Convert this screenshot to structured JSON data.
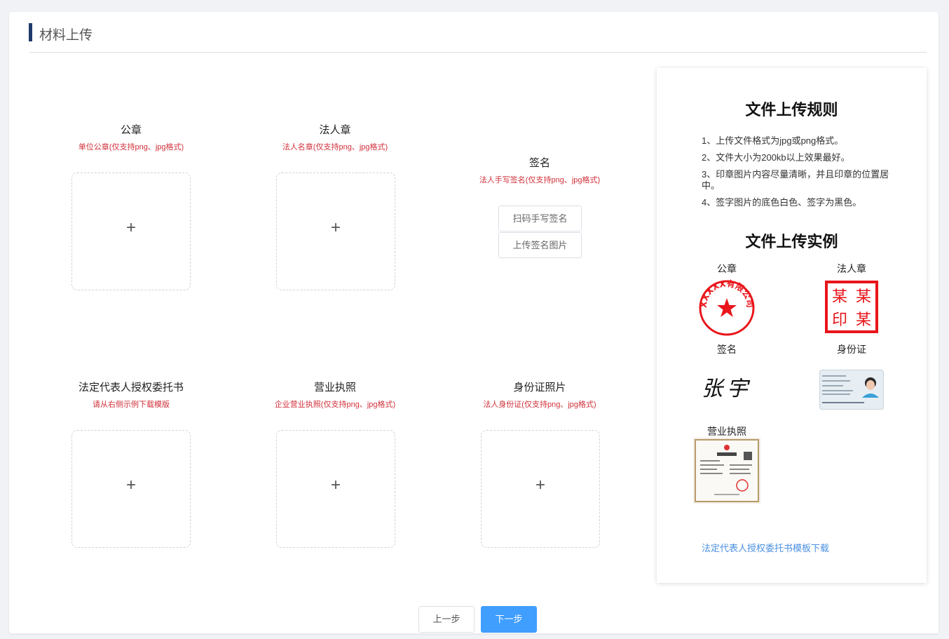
{
  "page": {
    "title": "材料上传"
  },
  "slots": {
    "seal": {
      "name": "公章",
      "hint": "单位公章(仅支持png、jpg格式)",
      "plus": "+"
    },
    "legal_seal": {
      "name": "法人章",
      "hint": "法人名章(仅支持png、jpg格式)",
      "plus": "+"
    },
    "signature": {
      "name": "签名",
      "hint": "法人手写签名(仅支持png、jpg格式)",
      "scan_button": "扫码手写签名",
      "upload_button": "上传签名图片"
    },
    "authorization": {
      "name": "法定代表人授权委托书",
      "hint": "请从右侧示例下载模版",
      "plus": "+"
    },
    "business_license": {
      "name": "营业执照",
      "hint": "企业营业执照(仅支持png、jpg格式)",
      "plus": "+"
    },
    "id_card": {
      "name": "身份证照片",
      "hint": "法人身份证(仅支持png、jpg格式)",
      "plus": "+"
    }
  },
  "rules": {
    "title": "文件上传规则",
    "items": [
      "1、上传文件格式为jpg或png格式。",
      "2、文件大小为200kb以上效果最好。",
      "3、印章图片内容尽量清晰，并且印章的位置居中。",
      "4、签字图片的底色白色、签字为黑色。"
    ],
    "examples_title": "文件上传实例",
    "examples": {
      "seal_label": "公章",
      "seal_text": "XXXXX有限公司",
      "legal_seal_label": "法人章",
      "legal_seal_chars": [
        "某",
        "某",
        "印",
        "某"
      ],
      "signature_label": "签名",
      "signature_text": "张宇",
      "id_label": "身份证",
      "license_label": "营业执照"
    },
    "download_link": "法定代表人授权委托书模板下载"
  },
  "nav": {
    "prev": "上一步",
    "next": "下一步"
  },
  "colors": {
    "accent": "#409eff",
    "hint_red": "#d0303a",
    "header_bar": "#1f3a6b",
    "link": "#4a90e2",
    "seal_red": "#e8151b"
  }
}
